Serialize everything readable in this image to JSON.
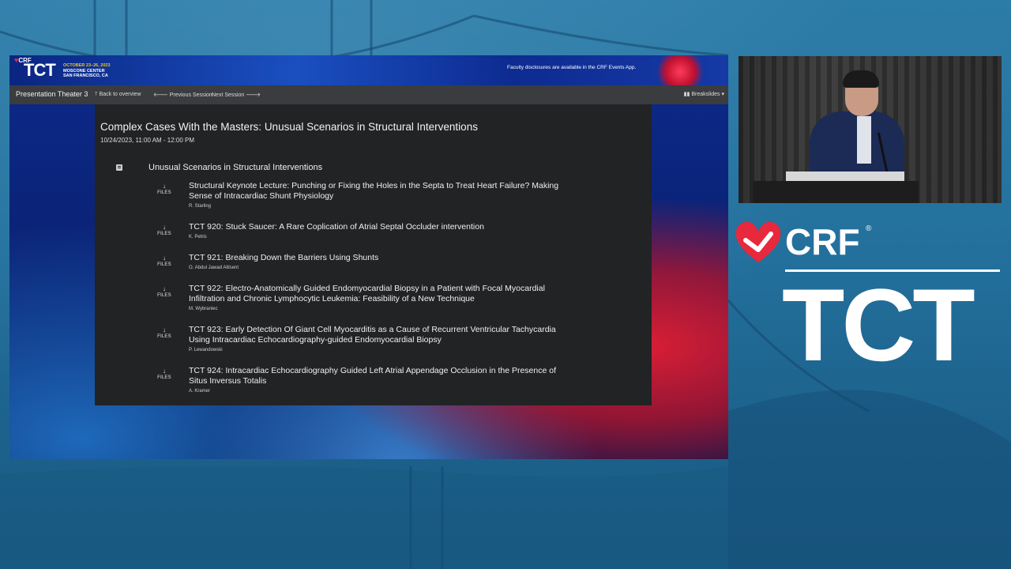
{
  "slide": {
    "header": {
      "crf": "CRF",
      "tct": "TCT",
      "event_date": "OCTOBER 23–26, 2023",
      "event_venue": "MOSCONE CENTER",
      "event_city": "SAN FRANCISCO, CA",
      "disclosure": "Faculty disclosures are available in the CRF Events App."
    },
    "nav": {
      "title": "Presentation Theater 3",
      "back": "Back to overview",
      "prev": "Previous Session",
      "next": "Next Session",
      "breakslides": "Breakslides"
    },
    "session": {
      "title": "Complex Cases With the Masters: Unusual Scenarios in Structural Interventions",
      "time": "10/24/2023, 11:00 AM - 12:00 PM",
      "group_title": "Unusual Scenarios in Structural Interventions",
      "files_label": "FILES",
      "items": [
        {
          "title": "Structural Keynote Lecture: Punching or Fixing the Holes in the Septa to Treat Heart Failure? Making Sense of Intracardiac Shunt Physiology",
          "author": "R. Starling"
        },
        {
          "title": "TCT 920: Stuck Saucer: A Rare Coplication of Atrial Septal Occluder intervention",
          "author": "K. Petris"
        },
        {
          "title": "TCT 921: Breaking Down the Barriers Using Shunts",
          "author": "O. Abdul Jawad Altisent"
        },
        {
          "title": "TCT 922: Electro-Anatomically Guided Endomyocardial Biopsy in a Patient with Focal Myocardial Infiltration and Chronic Lymphocytic Leukemia: Feasibility of a New Technique",
          "author": "M. Wybraniec"
        },
        {
          "title": "TCT 923: Early Detection Of Giant Cell Myocarditis as a Cause of Recurrent Ventricular Tachycardia Using Intracardiac Echocardiography-guided Endomyocardial Biopsy",
          "author": "P. Lewandowski"
        },
        {
          "title": "TCT 924: Intracardiac Echocardiography Guided Left Atrial Appendage Occlusion in the Presence of Situs Inversus Totalis",
          "author": "A. Kramer"
        }
      ]
    }
  },
  "brand": {
    "crf": "CRF",
    "reg": "®",
    "tct": "TCT"
  },
  "colors": {
    "background": "#23709c",
    "accent_red": "#e8283c",
    "accent_gold": "#f5c21a",
    "panel": "#222324",
    "navbar": "#3a3c3f"
  }
}
